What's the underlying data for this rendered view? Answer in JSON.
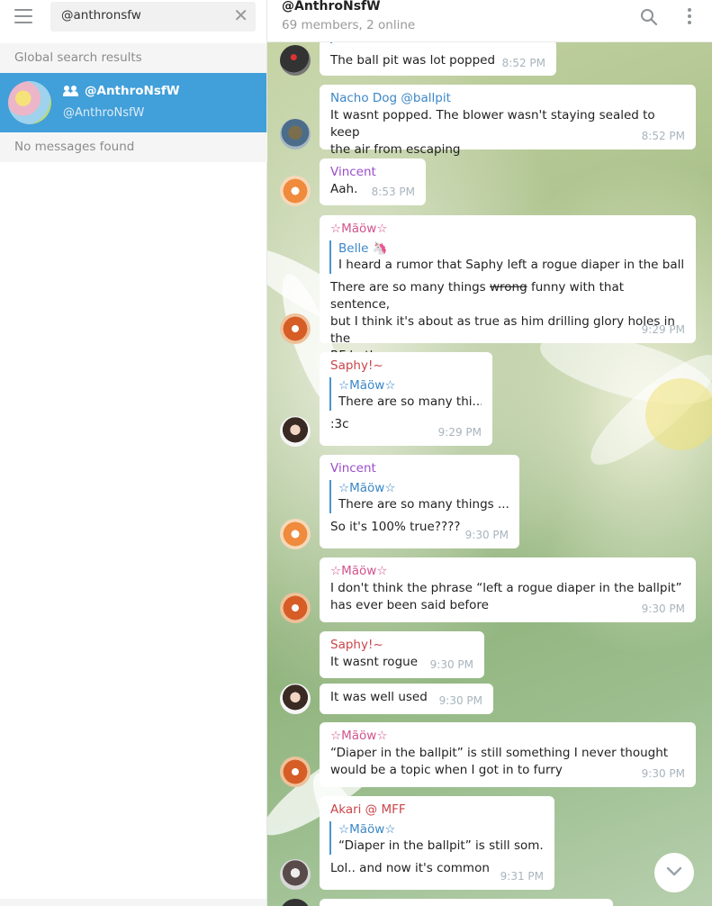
{
  "search": {
    "value": "@anthronsfw",
    "clear": "✕"
  },
  "left": {
    "global_header": "Global search results",
    "result": {
      "title": "@AnthroNsfW",
      "subtitle": "@AnthroNsfW"
    },
    "no_messages": "No messages found"
  },
  "chat": {
    "title": "@AnthroNsfW",
    "status": "69 members, 2 online"
  },
  "colors": {
    "accent": "#419fd9",
    "vincent": "#9b4dca",
    "maow": "#d2548e",
    "saphy": "#c9464a",
    "nacho": "#3c87c7",
    "akari": "#c9464a"
  },
  "messages": [
    {
      "text": "The ball pit was lot popped",
      "time": "8:52 PM"
    },
    {
      "sender": "Nacho Dog @ballpit",
      "text1": "It wasnt popped. The blower wasn't staying sealed to keep",
      "text2": "the air from escaping",
      "time": "8:52 PM"
    },
    {
      "sender": "Vincent",
      "text": "Aah.",
      "time": "8:53 PM"
    },
    {
      "sender": "☆Mãöw☆",
      "reply_name": "Belle 🦄",
      "reply_text": "I heard a rumor that Saphy left a rogue diaper in the ball...",
      "text1a": "There are so many things ",
      "text1_strike": "wrong",
      "text1b": " funny with that sentence,",
      "text2": "but I think it's about as true as him drilling glory holes in the",
      "text3": "RF bathroom",
      "time": "9:29 PM"
    },
    {
      "sender": "Saphy!~",
      "reply_name": "☆Mãöw☆",
      "reply_text": "There are so many thi...",
      "text": ":3c",
      "time": "9:29 PM"
    },
    {
      "sender": "Vincent",
      "reply_name": "☆Mãöw☆",
      "reply_text": "There are so many things ...",
      "text": "So it's 100% true????",
      "time": "9:30 PM"
    },
    {
      "sender": "☆Mãöw☆",
      "text1": "I don't think the phrase “left a rogue diaper in the ballpit”",
      "text2": "has ever been said before",
      "time": "9:30 PM"
    },
    {
      "sender": "Saphy!~",
      "text": "It wasnt rogue",
      "time": "9:30 PM"
    },
    {
      "text": "It was well used",
      "time": "9:30 PM"
    },
    {
      "sender": "☆Mãöw☆",
      "text1": "“Diaper in the ballpit” is still something I never thought",
      "text2": "would be a topic when I got in to furry",
      "time": "9:30 PM"
    },
    {
      "sender": "Akari @ MFF",
      "reply_name": "☆Mãöw☆",
      "reply_text": "“Diaper in the ballpit” is still som...",
      "text": "Lol.. and now it's common",
      "time": "9:31 PM"
    }
  ]
}
